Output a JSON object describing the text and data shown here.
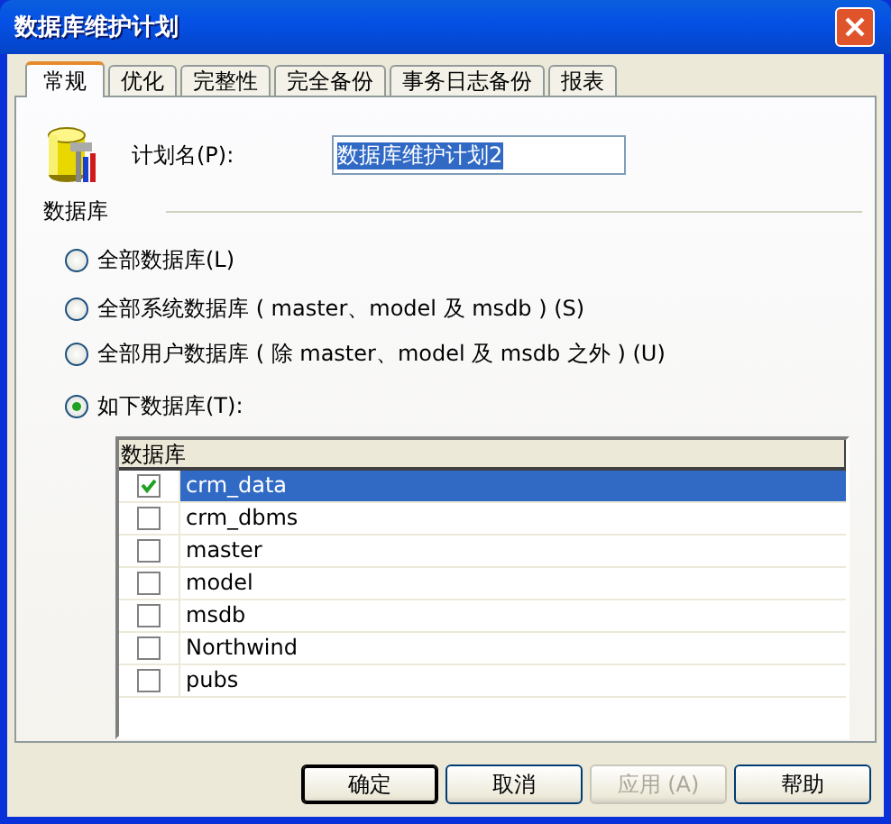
{
  "window": {
    "title": "数据库维护计划"
  },
  "tabs": [
    {
      "label": "常规",
      "selected": true
    },
    {
      "label": "优化",
      "selected": false
    },
    {
      "label": "完整性",
      "selected": false
    },
    {
      "label": "完全备份",
      "selected": false
    },
    {
      "label": "事务日志备份",
      "selected": false
    },
    {
      "label": "报表",
      "selected": false
    }
  ],
  "plan_name": {
    "label": "计划名(P):",
    "value": "数据库维护计划2",
    "text_selected": true
  },
  "database_group": {
    "title": "数据库",
    "options": [
      {
        "label": "全部数据库(L)",
        "selected": false
      },
      {
        "label": "全部系统数据库 ( master、model 及 msdb ) (S)",
        "selected": false
      },
      {
        "label": "全部用户数据库 ( 除 master、model 及 msdb 之外 ) (U)",
        "selected": false
      },
      {
        "label": "如下数据库(T):",
        "selected": true
      }
    ],
    "list": {
      "column": "数据库",
      "rows": [
        {
          "name": "crm_data",
          "checked": true,
          "selected": true
        },
        {
          "name": "crm_dbms",
          "checked": false,
          "selected": false
        },
        {
          "name": "master",
          "checked": false,
          "selected": false
        },
        {
          "name": "model",
          "checked": false,
          "selected": false
        },
        {
          "name": "msdb",
          "checked": false,
          "selected": false
        },
        {
          "name": "Northwind",
          "checked": false,
          "selected": false
        },
        {
          "name": "pubs",
          "checked": false,
          "selected": false
        }
      ]
    }
  },
  "buttons": [
    {
      "label": "确定",
      "default": true,
      "disabled": false
    },
    {
      "label": "取消",
      "default": false,
      "disabled": false
    },
    {
      "label": "应用 (A)",
      "default": false,
      "disabled": true
    },
    {
      "label": "帮助",
      "default": false,
      "disabled": false
    }
  ]
}
